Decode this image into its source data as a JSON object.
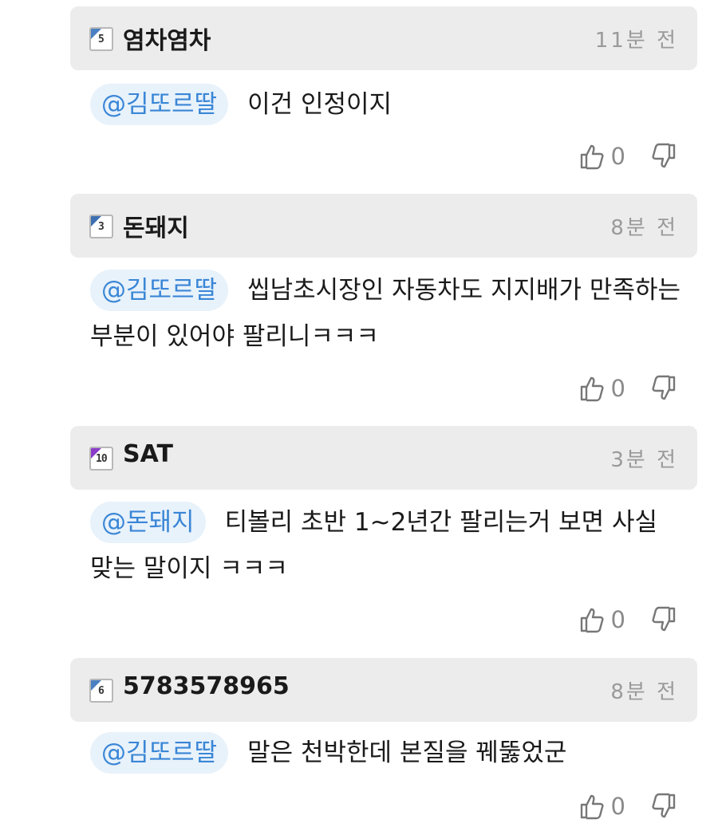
{
  "comments": [
    {
      "level": "5",
      "level_color": "#4a7fc1",
      "username": "염차염차",
      "time": "11분 전",
      "mention": "@김또르딸",
      "text": "이건 인정이지",
      "likes": "0"
    },
    {
      "level": "3",
      "level_color": "#3c6fb0",
      "username": "돈돼지",
      "time": "8분 전",
      "mention": "@김또르딸",
      "text": "씹남초시장인 자동차도 지지배가 만족하는 부분이 있어야 팔리니ㅋㅋㅋ",
      "likes": "0"
    },
    {
      "level": "10",
      "level_color": "#8a3cc9",
      "username": "SAT",
      "time": "3분 전",
      "mention": "@돈돼지",
      "text": "티볼리 초반 1~2년간 팔리는거 보면 사실 맞는 말이지 ㅋㅋㅋ",
      "likes": "0"
    },
    {
      "level": "6",
      "level_color": "#4a7fc1",
      "username": "5783578965",
      "time": "8분 전",
      "mention": "@김또르딸",
      "text": "말은 천박한데 본질을 꿰뚫었군",
      "likes": "0"
    }
  ],
  "icons": {
    "like": "thumbs-up-icon",
    "dislike": "thumbs-down-icon"
  }
}
